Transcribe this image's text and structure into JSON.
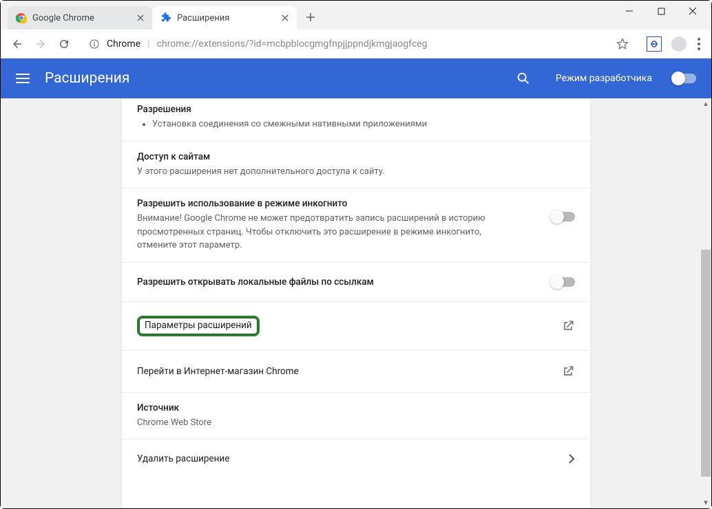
{
  "window": {
    "tabs": [
      {
        "title": "Google Chrome",
        "favicon": "chrome"
      },
      {
        "title": "Расширения",
        "favicon": "extension"
      }
    ]
  },
  "address": {
    "label": "Chrome",
    "url": "chrome://extensions/?id=mcbpblocgmgfnpjjppndjkmgjaogfceg"
  },
  "ext_header": {
    "title": "Расширения",
    "developer_mode": "Режим разработчика"
  },
  "sections": {
    "permissions": {
      "heading": "Разрешения",
      "item1": "Установка соединения со смежными нативными приложениями"
    },
    "site_access": {
      "heading": "Доступ к сайтам",
      "body": "У этого расширения нет дополнительного доступа к сайту."
    },
    "incognito": {
      "heading": "Разрешить использование в режиме инкогнито",
      "body": "Внимание! Google Chrome не может предотвратить запись расширений в историю просмотренных страниц. Чтобы отключить это расширение в режиме инкогнито, отмените этот параметр."
    },
    "file_urls": {
      "heading": "Разрешить открывать локальные файлы по ссылкам"
    },
    "options": {
      "label": "Параметры расширений"
    },
    "webstore": {
      "label": "Перейти в Интернет-магазин Chrome"
    },
    "source": {
      "heading": "Источник",
      "body": "Chrome Web Store"
    },
    "remove": {
      "label": "Удалить расширение"
    }
  }
}
